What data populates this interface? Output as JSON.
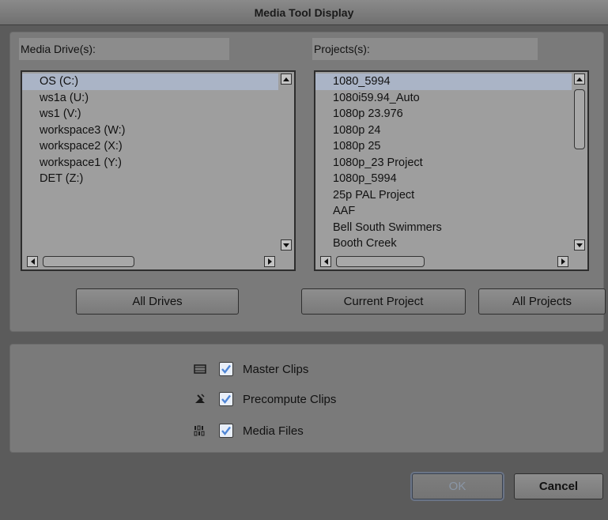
{
  "window": {
    "title": "Media Tool Display"
  },
  "drives": {
    "label": "Media Drive(s):",
    "items": [
      "OS (C:)",
      "ws1a (U:)",
      "ws1 (V:)",
      "workspace3 (W:)",
      "workspace2 (X:)",
      "workspace1 (Y:)",
      "DET (Z:)"
    ],
    "selected": "OS (C:)"
  },
  "projects": {
    "label": "Projects(s):",
    "items": [
      "1080_5994",
      "1080i59.94_Auto",
      "1080p 23.976",
      "1080p 24",
      "1080p 25",
      "1080p_23 Project",
      "1080p_5994",
      "25p PAL Project",
      "AAF",
      "Bell South Swimmers",
      "Booth Creek"
    ],
    "selected": "1080_5994"
  },
  "buttons": {
    "all_drives": "All Drives",
    "current_project": "Current Project",
    "all_projects": "All Projects",
    "ok": "OK",
    "cancel": "Cancel"
  },
  "options": [
    {
      "label": "Master Clips",
      "checked": true,
      "icon": "master-clip-icon"
    },
    {
      "label": "Precompute Clips",
      "checked": true,
      "icon": "precompute-clip-icon"
    },
    {
      "label": "Media Files",
      "checked": true,
      "icon": "media-file-icon"
    }
  ],
  "colors": {
    "accent": "#4f86d6",
    "selection": "#aab4c6",
    "list_bg": "#9e9e9e"
  }
}
